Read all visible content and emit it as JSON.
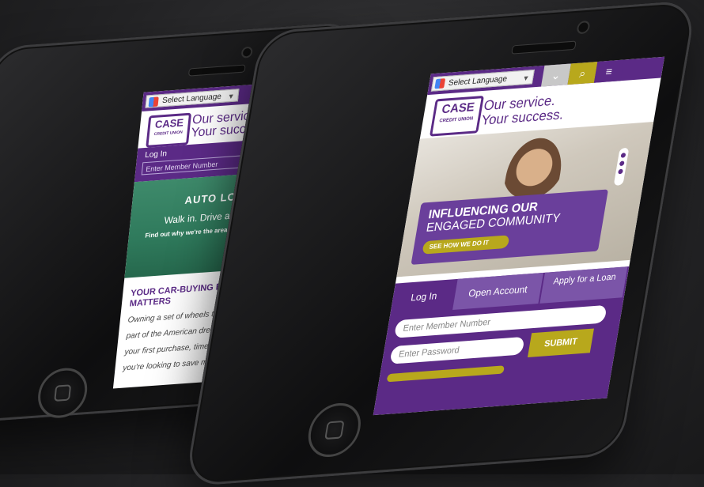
{
  "left_phone": {
    "language_select": "Select Language",
    "logo": "CASE",
    "logo_sub": "CREDIT UNION",
    "tagline_1": "Our service.",
    "tagline_2": "Your success.",
    "login_label": "Log In",
    "member_placeholder": "Enter Member Number",
    "hero_title": "AUTO LOANS",
    "hero_sub": "Walk in. Drive away happy.",
    "hero_cta": "Find out why we're the area's leading auto lender.",
    "article_title_1": "YOUR CAR-BUYING EXPERIENCE",
    "article_title_2": "MATTERS",
    "article_lines": [
      "Owning a set of wheels that you love is",
      "part of the American dream. Whether it's",
      "your first purchase, time for an upgrade or",
      "you're looking to save money with a"
    ]
  },
  "right_phone": {
    "language_select": "Select Language",
    "logo": "CASE",
    "logo_sub": "CREDIT UNION",
    "tagline_1": "Our service.",
    "tagline_2": "Your success.",
    "promo_title_1": "INFLUENCING OUR",
    "promo_title_2": "ENGAGED COMMUNITY",
    "promo_button": "SEE HOW WE DO IT",
    "tabs": [
      "Log In",
      "Open Account",
      "Apply for a Loan"
    ],
    "member_placeholder": "Enter Member Number",
    "password_placeholder": "Enter Password",
    "submit_label": "SUBMIT"
  },
  "colors": {
    "brand_purple": "#5b2a86",
    "brand_gold": "#b8a81c",
    "hero_green": "#2f7a5c"
  }
}
